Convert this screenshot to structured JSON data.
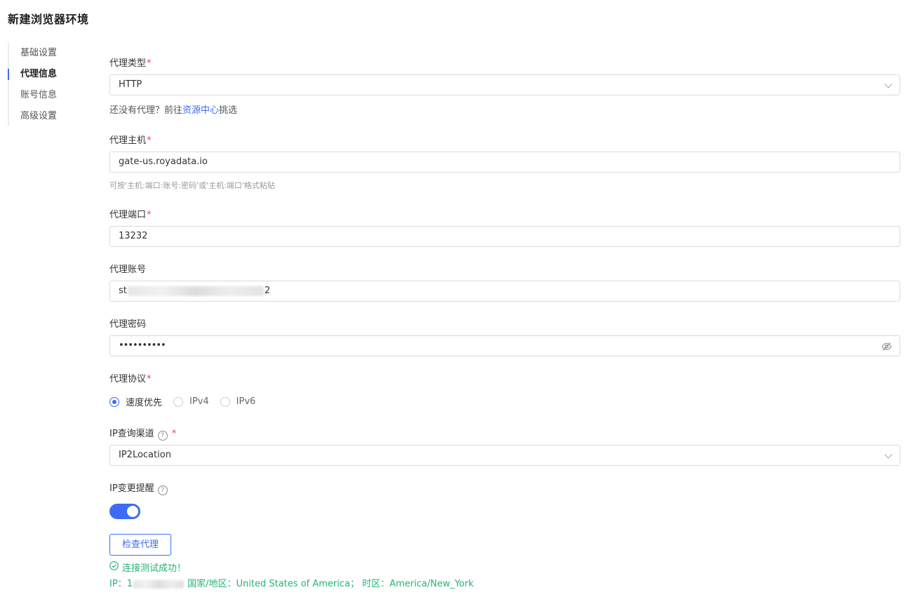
{
  "page": {
    "title": "新建浏览器环境"
  },
  "sidebar": {
    "items": [
      {
        "label": "基础设置",
        "active": false
      },
      {
        "label": "代理信息",
        "active": true
      },
      {
        "label": "账号信息",
        "active": false
      },
      {
        "label": "高级设置",
        "active": false
      }
    ]
  },
  "form": {
    "proxy_type": {
      "label": "代理类型",
      "required_mark": "*",
      "value": "HTTP"
    },
    "proxy_hint": {
      "prefix": "还没有代理？前往",
      "link": "资源中心",
      "suffix": "挑选"
    },
    "proxy_host": {
      "label": "代理主机",
      "required_mark": "*",
      "value": "gate-us.royadata.io",
      "hint": "可按'主机:端口:账号:密码'或'主机:端口'格式粘贴"
    },
    "proxy_port": {
      "label": "代理端口",
      "required_mark": "*",
      "value": "13232"
    },
    "proxy_account": {
      "label": "代理账号",
      "value_prefix": "st",
      "value_suffix": "2"
    },
    "proxy_password": {
      "label": "代理密码",
      "value": "••••••••••"
    },
    "proxy_protocol": {
      "label": "代理协议",
      "required_mark": "*",
      "options": [
        {
          "label": "速度优先",
          "checked": true
        },
        {
          "label": "IPv4",
          "checked": false
        },
        {
          "label": "IPv6",
          "checked": false
        }
      ]
    },
    "ip_channel": {
      "label": "IP查询渠道",
      "required_mark": "*",
      "value": "IP2Location",
      "help_icon": "?"
    },
    "ip_change_alert": {
      "label": "IP变更提醒",
      "help_icon": "?",
      "enabled": true
    },
    "check_button": {
      "label": "检查代理"
    },
    "result": {
      "success_text": "连接测试成功！",
      "ip_label": "IP：",
      "ip_visible_prefix": "1",
      "ip_visible_suffix": "",
      "country_label": "国家/地区：",
      "country_value": "United States of America；",
      "timezone_label": "时区：",
      "timezone_value": "America/New_York"
    }
  },
  "colors": {
    "accent": "#3c6cf5",
    "success": "#22b573",
    "required": "#e5484d"
  }
}
